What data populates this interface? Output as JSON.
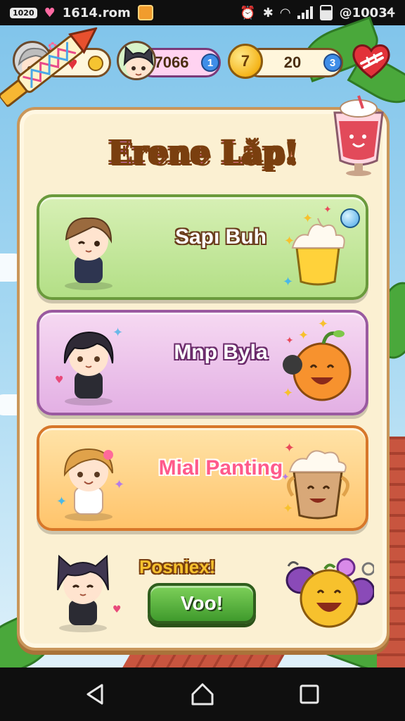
{
  "status_bar": {
    "left_badge": "1020",
    "app_title": "1614.rom",
    "clock": "@1003Ꮞ"
  },
  "hud": {
    "player_pill_value": "",
    "gems_value": "7066",
    "gems_badge": "1",
    "coin_symbol": "7",
    "coins_value": "20",
    "coins_badge": "3"
  },
  "panel": {
    "title": "Erene Lăp!"
  },
  "cards": [
    {
      "name": "Sapı Buh",
      "theme": "green",
      "food_icon": "whipped-cream-cup-icon"
    },
    {
      "name": "Mnp Byla",
      "theme": "pink",
      "food_icon": "smiling-orange-icon"
    },
    {
      "name": "Mial Panting",
      "theme": "orange",
      "food_icon": "iced-coffee-cup-icon"
    }
  ],
  "promo": {
    "label": "Posniex!",
    "button_label": "Voo!"
  },
  "colors": {
    "accent_gold": "#f4b634",
    "green_button": "#3f9a2c",
    "panel_bg": "#fbf0d2"
  }
}
